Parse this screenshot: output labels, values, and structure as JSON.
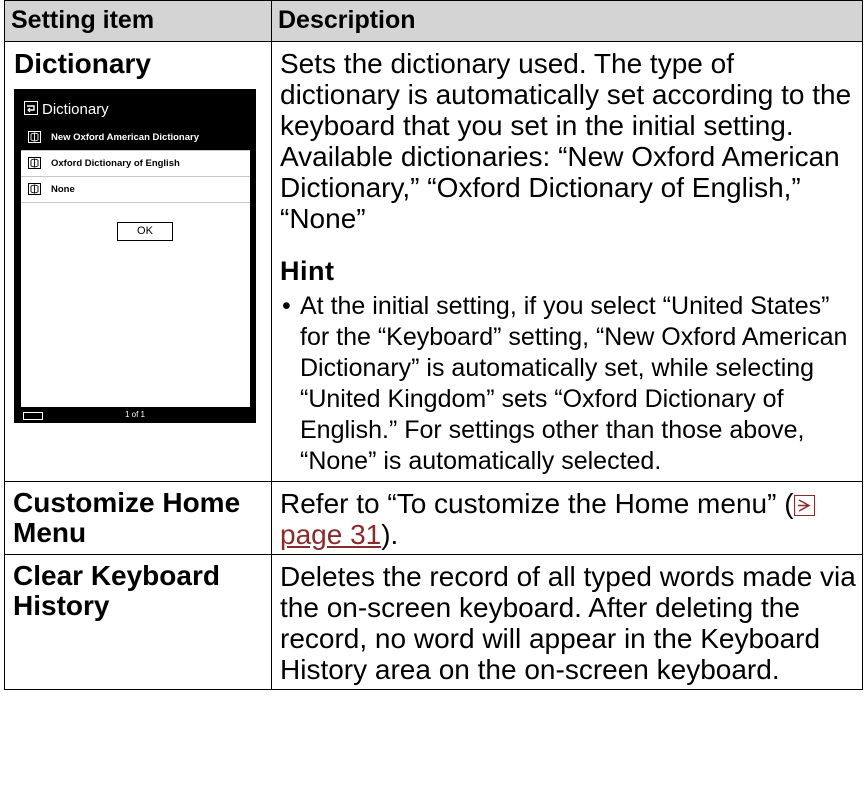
{
  "table": {
    "header": {
      "col1": "Setting item",
      "col2": "Description"
    },
    "rows": [
      {
        "item": "Dictionary",
        "description": "Sets the dictionary used. The type of dictionary is automatically set according to the keyboard that you set in the initial setting.",
        "available": "Available dictionaries: “New Oxford American Dictionary,” “Oxford Dictionary of English,” “None”",
        "hint_title": "Hint",
        "hint_items": [
          "At the initial setting, if you select “United States” for the “Keyboard” setting, “New Oxford American Dictionary” is automatically set, while selecting “United Kingdom” sets “Oxford Dictionary of English.” For settings other than those above, “None” is automatically selected."
        ]
      },
      {
        "item": "Customize Home Menu",
        "description_prefix": "Refer to “To customize the Home menu” (",
        "link_text": "page 31",
        "description_suffix": ")."
      },
      {
        "item": "Clear Keyboard History",
        "description": "Deletes the record of all typed words made via the on-screen keyboard. After deleting the record, no word will appear in the Keyboard History area on the on-screen keyboard."
      }
    ]
  },
  "device": {
    "title": "Dictionary",
    "options": [
      {
        "label": "New Oxford American Dictionary",
        "selected": true
      },
      {
        "label": "Oxford Dictionary of English",
        "selected": false
      },
      {
        "label": "None",
        "selected": false
      }
    ],
    "ok_label": "OK",
    "page_indicator": "1 of 1"
  },
  "colors": {
    "header_bg": "#d4d4d4",
    "link": "#8a2b2b",
    "device_bg": "#000000"
  },
  "icons": [
    "back-icon",
    "book-icon",
    "battery-icon",
    "page-arrow-icon"
  ]
}
